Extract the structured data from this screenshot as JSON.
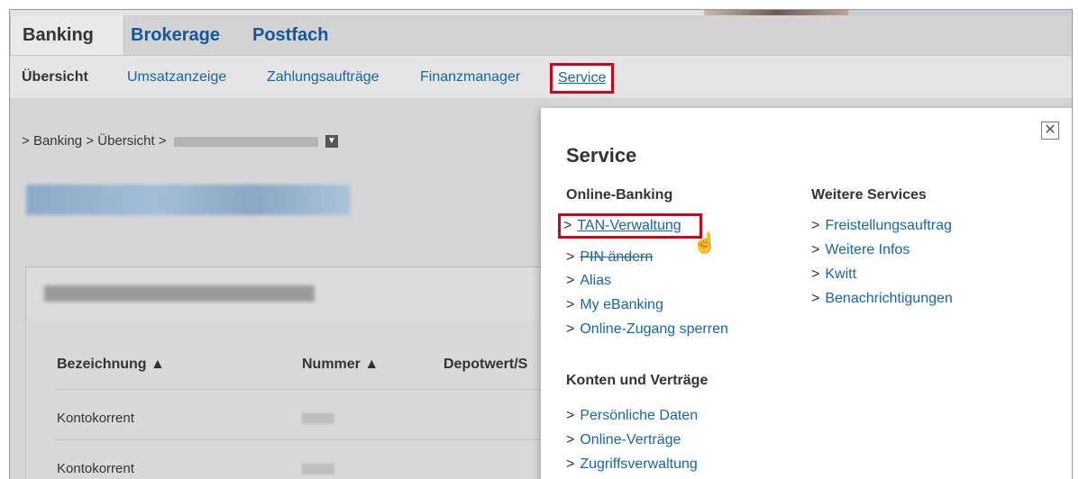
{
  "tabs_primary": [
    "Banking",
    "Brokerage",
    "Postfach"
  ],
  "tabs_secondary": [
    "Übersicht",
    "Umsatzanzeige",
    "Zahlungsaufträge",
    "Finanzmanager",
    "Service"
  ],
  "breadcrumb": {
    "items": [
      "Banking",
      "Übersicht"
    ]
  },
  "table": {
    "headers": [
      "Bezeichnung",
      "Nummer",
      "Depotwert/S"
    ],
    "rows": [
      {
        "name": "Kontokorrent"
      },
      {
        "name": "Kontokorrent"
      }
    ]
  },
  "popup": {
    "title": "Service",
    "close_icon": "close-icon",
    "left_column": {
      "heading": "Online-Banking",
      "links": [
        "TAN-Verwaltung",
        "PIN ändern",
        "Alias",
        "My eBanking",
        "Online-Zugang sperren"
      ]
    },
    "lower_column": {
      "heading": "Konten und Verträge",
      "links": [
        "Persönliche Daten",
        "Online-Verträge",
        "Zugriffsverwaltung"
      ]
    },
    "right_column": {
      "heading": "Weitere Services",
      "links": [
        "Freistellungsauftrag",
        "Weitere Infos",
        "Kwitt",
        "Benachrichtigungen"
      ]
    }
  },
  "colors": {
    "link": "#1565a8",
    "highlight": "#d0021b",
    "text": "#333333"
  },
  "icons": {
    "chevron": "chevron-right-icon",
    "sort": "sort-icon",
    "cursor": "hand-pointer-icon"
  }
}
